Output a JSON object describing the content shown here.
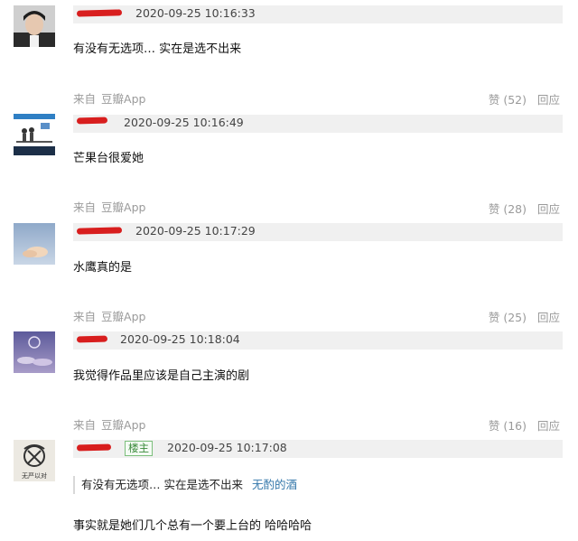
{
  "comments": [
    {
      "timestamp": "2020-09-25 10:16:33",
      "text": "有没有无选项… 实在是选不出来",
      "source_label": "来自",
      "source_app": "豆瓣App",
      "like_label": "赞 (52)",
      "reply_label": "回应"
    },
    {
      "timestamp": "2020-09-25 10:16:49",
      "text": "芒果台很爱她",
      "source_label": "来自",
      "source_app": "豆瓣App",
      "like_label": "赞 (28)",
      "reply_label": "回应"
    },
    {
      "timestamp": "2020-09-25 10:17:29",
      "text": "水鹰真的是",
      "source_label": "来自",
      "source_app": "豆瓣App",
      "like_label": "赞 (25)",
      "reply_label": "回应"
    },
    {
      "timestamp": "2020-09-25 10:18:04",
      "text": "我觉得作品里应该是自己主演的剧",
      "source_label": "来自",
      "source_app": "豆瓣App",
      "like_label": "赞 (16)",
      "reply_label": "回应"
    },
    {
      "timestamp": "2020-09-25 10:17:08",
      "op_badge": "楼主",
      "quote_text": "有没有无选项… 实在是选不出来",
      "quote_author": "无酌的酒",
      "text": "事实就是她们几个总有一个要上台的 哈哈哈哈"
    }
  ],
  "avatar_5_caption": "无严以对",
  "colors": {
    "redaction": "#d81e1e",
    "meta_bar": "#f0f0f0",
    "link": "#3377aa",
    "op_badge": "#3a8a3a"
  }
}
